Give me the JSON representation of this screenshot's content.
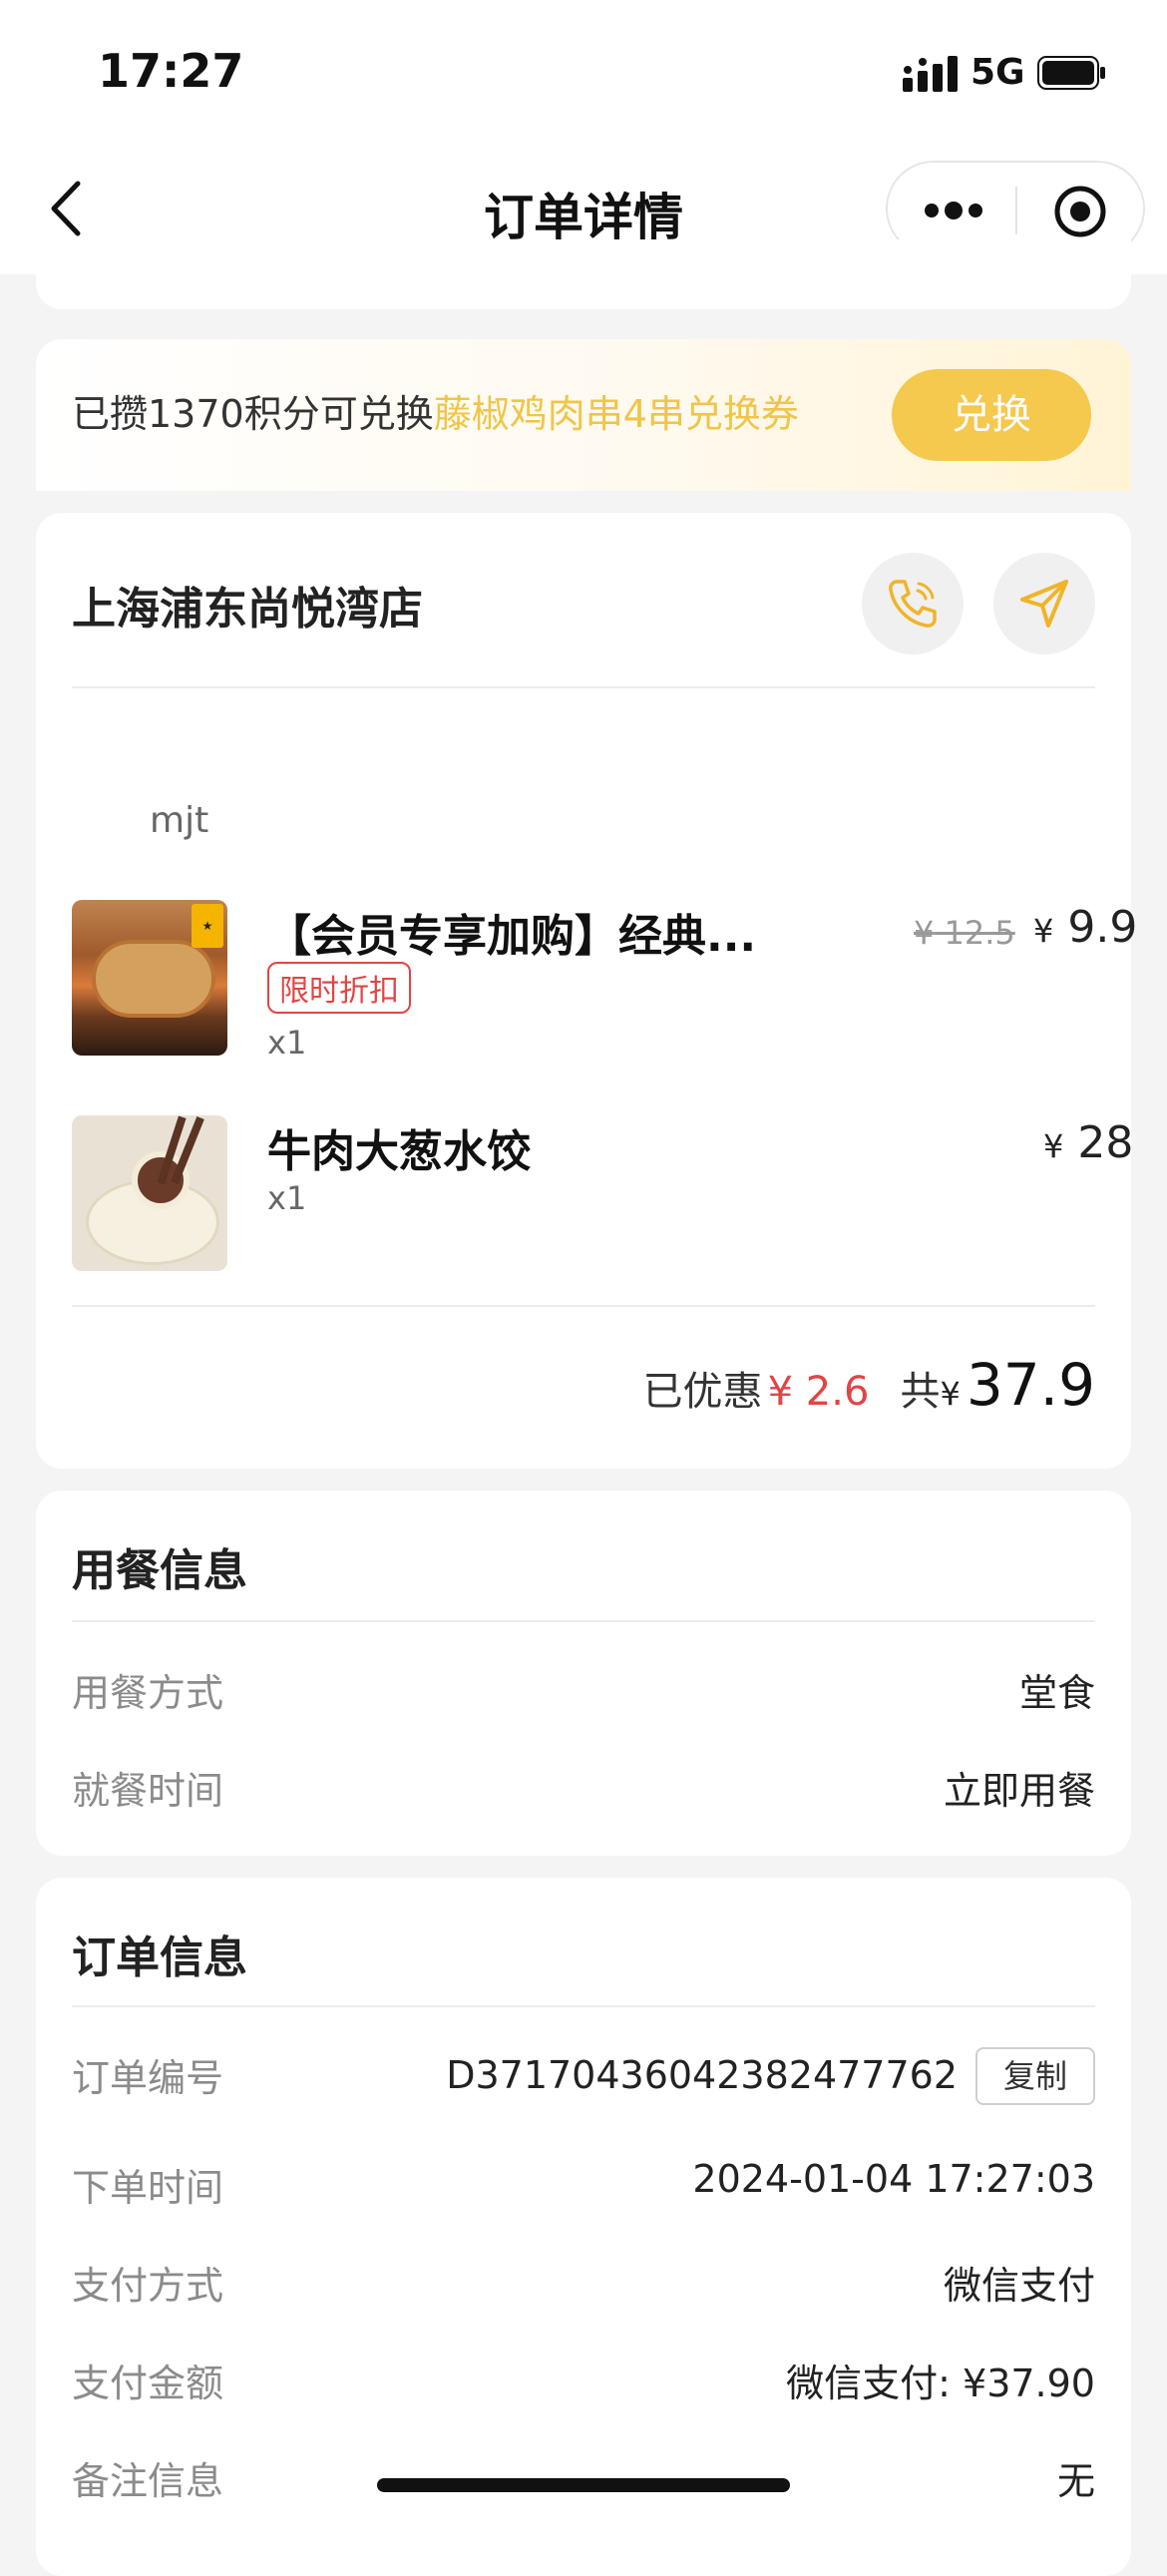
{
  "status_bar": {
    "time": "17:27",
    "network": "5G"
  },
  "nav": {
    "title": "订单详情"
  },
  "points_banner": {
    "prefix": "已攒1370积分可兑换",
    "highlight": "藤椒鸡肉串4串兑换券",
    "button": "兑换",
    "highlight_color": "#f0c548",
    "button_color": "#f5c84e"
  },
  "store": {
    "name": "上海浦东尚悦湾店",
    "user_label": "mjt",
    "items": [
      {
        "name": "【会员专享加购】经典...",
        "tag": "限时折扣",
        "qty": "x1",
        "orig_price_symbol": "¥",
        "orig_price": "12.5",
        "price_symbol": "¥",
        "price": "9.9"
      },
      {
        "name": "牛肉大葱水饺",
        "qty": "x1",
        "price_symbol": "¥",
        "price": "28"
      }
    ],
    "discount_label": "已优惠",
    "discount_amount": "¥ 2.6",
    "total_label": "共",
    "total_symbol": "¥",
    "total": "37.9",
    "discount_color": "#e04545"
  },
  "dining": {
    "title": "用餐信息",
    "rows": [
      {
        "label": "用餐方式",
        "value": "堂食"
      },
      {
        "label": "就餐时间",
        "value": "立即用餐"
      }
    ]
  },
  "order": {
    "title": "订单信息",
    "id_label": "订单编号",
    "id_value": "D37170436042382477762",
    "copy_button": "复制",
    "rows": [
      {
        "label": "下单时间",
        "value": "2024-01-04 17:27:03"
      },
      {
        "label": "支付方式",
        "value": "微信支付"
      },
      {
        "label": "支付金额",
        "value": "微信支付: ¥37.90"
      },
      {
        "label": "备注信息",
        "value": "无"
      }
    ]
  }
}
